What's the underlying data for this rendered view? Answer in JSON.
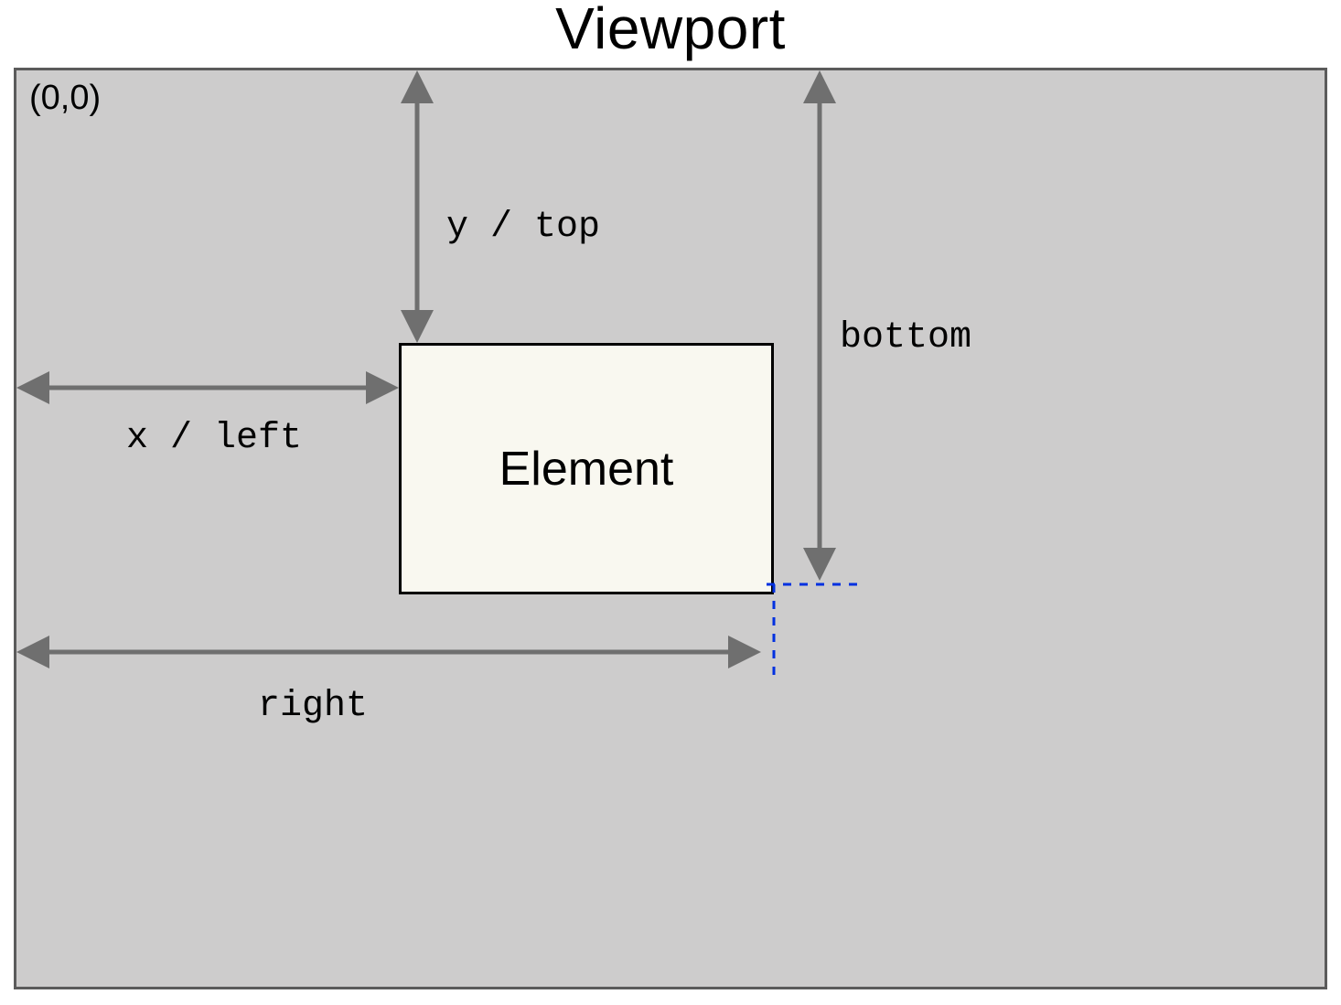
{
  "title": "Viewport",
  "origin_label": "(0,0)",
  "element_label": "Element",
  "measures": {
    "y_top": "y / top",
    "x_left": "x / left",
    "bottom": "bottom",
    "right": "right"
  }
}
